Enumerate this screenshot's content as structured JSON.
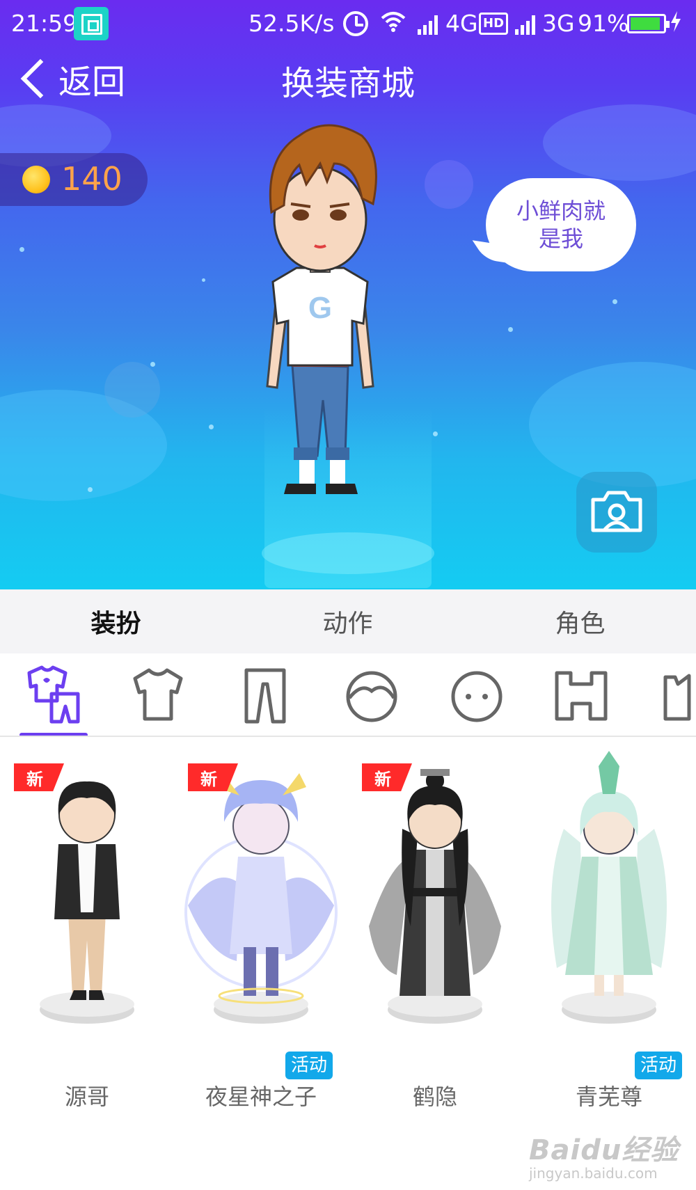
{
  "status_bar": {
    "time": "21:59",
    "net_speed": "52.5K/s",
    "net1_label": "4G",
    "hd_badge": "HD",
    "net2_label": "3G",
    "battery_percent": "91%",
    "battery_level": 0.91,
    "icons": [
      "screenshot-icon",
      "alarm-icon",
      "wifi-icon",
      "signal-icon",
      "battery-icon",
      "charging-icon"
    ]
  },
  "nav": {
    "back_label": "返回",
    "title": "换装商城"
  },
  "coins": {
    "count": "140",
    "icon": "coin-icon"
  },
  "speech_bubble": {
    "line1": "小鲜肉就",
    "line2": "是我"
  },
  "avatar": {
    "shirt_logo": "G"
  },
  "camera_button": {
    "icon": "camera-portrait-icon"
  },
  "tabs": [
    {
      "label": "装扮",
      "active": true
    },
    {
      "label": "动作",
      "active": false
    },
    {
      "label": "角色",
      "active": false
    }
  ],
  "categories": [
    {
      "icon": "outfit-set-icon",
      "selected": true
    },
    {
      "icon": "shirt-icon",
      "selected": false
    },
    {
      "icon": "pants-icon",
      "selected": false
    },
    {
      "icon": "hair-icon",
      "selected": false
    },
    {
      "icon": "face-icon",
      "selected": false
    },
    {
      "icon": "underwear-icon",
      "selected": false
    },
    {
      "icon": "crown-icon",
      "selected": false
    }
  ],
  "items": [
    {
      "name": "源哥",
      "badge_new": "新",
      "badge_event": ""
    },
    {
      "name": "夜星神之子",
      "badge_new": "新",
      "badge_event": "活动"
    },
    {
      "name": "鹤隐",
      "badge_new": "新",
      "badge_event": ""
    },
    {
      "name": "青芜尊",
      "badge_new": "",
      "badge_event": "活动"
    }
  ],
  "watermark": {
    "main": "Baidu经验",
    "sub": "jingyan.baidu.com"
  },
  "colors": {
    "accent": "#6c3ff0",
    "new_badge": "#ff2a2a",
    "event_badge": "#12a8ea",
    "coin_text": "#ffa34a",
    "bubble_text": "#6e4ed6"
  }
}
